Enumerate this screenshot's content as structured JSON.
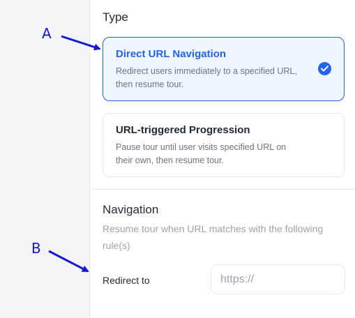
{
  "type_section": {
    "title": "Type",
    "options": [
      {
        "title": "Direct URL Navigation",
        "description": "Redirect users immediately to a specified URL, then resume tour.",
        "selected": true
      },
      {
        "title": "URL-triggered Progression",
        "description": "Pause tour until user visits specified URL on their own, then resume tour.",
        "selected": false
      }
    ]
  },
  "navigation_section": {
    "title": "Navigation",
    "description": "Resume tour when URL matches with the following rule(s)",
    "redirect_label": "Redirect to",
    "url_placeholder": "https://",
    "url_value": ""
  },
  "annotations": {
    "a": "A",
    "b": "B",
    "color": "#1616d6"
  },
  "colors": {
    "accent": "#2563eb",
    "selected_bg": "#eff6ff",
    "muted_text": "#6b7280"
  }
}
